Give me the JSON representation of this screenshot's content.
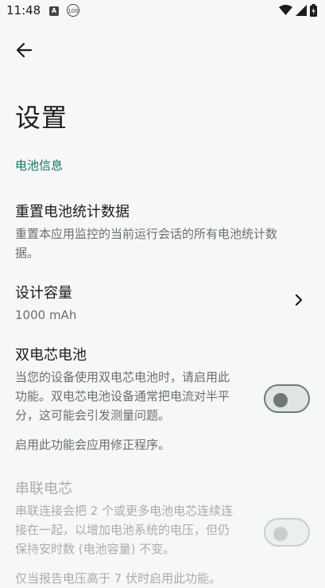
{
  "status_bar": {
    "time": "11:48",
    "notif_a": "A",
    "notif_100": "100"
  },
  "page": {
    "title": "设置"
  },
  "section": {
    "header": "电池信息"
  },
  "prefs": {
    "reset": {
      "title": "重置电池统计数据",
      "summary_1": "重置本应用监控的当前运行会话的所有电池统计数",
      "summary_2": "据。"
    },
    "capacity": {
      "title": "设计容量",
      "value": "1000 mAh"
    },
    "dual": {
      "title": "双电芯电池",
      "summary_1": "当您的设备使用双电芯电池时，请启用此",
      "summary_2": "功能。双电芯电池设备通常把电流对半平",
      "summary_3": "分，这可能会引发测量问题。",
      "note": "启用此功能会应用修正程序。",
      "checked": false
    },
    "series": {
      "title": "串联电芯",
      "summary_1": "串联连接会把 2 个或更多电池电芯连续连",
      "summary_2": "接在一起，以增加电池系统的电压，但仍",
      "summary_3": "保持安时数 (电池容量) 不变。",
      "note": "仅当报告电压高于 7 伏时启用此功能。",
      "checked": false,
      "enabled": false
    }
  }
}
